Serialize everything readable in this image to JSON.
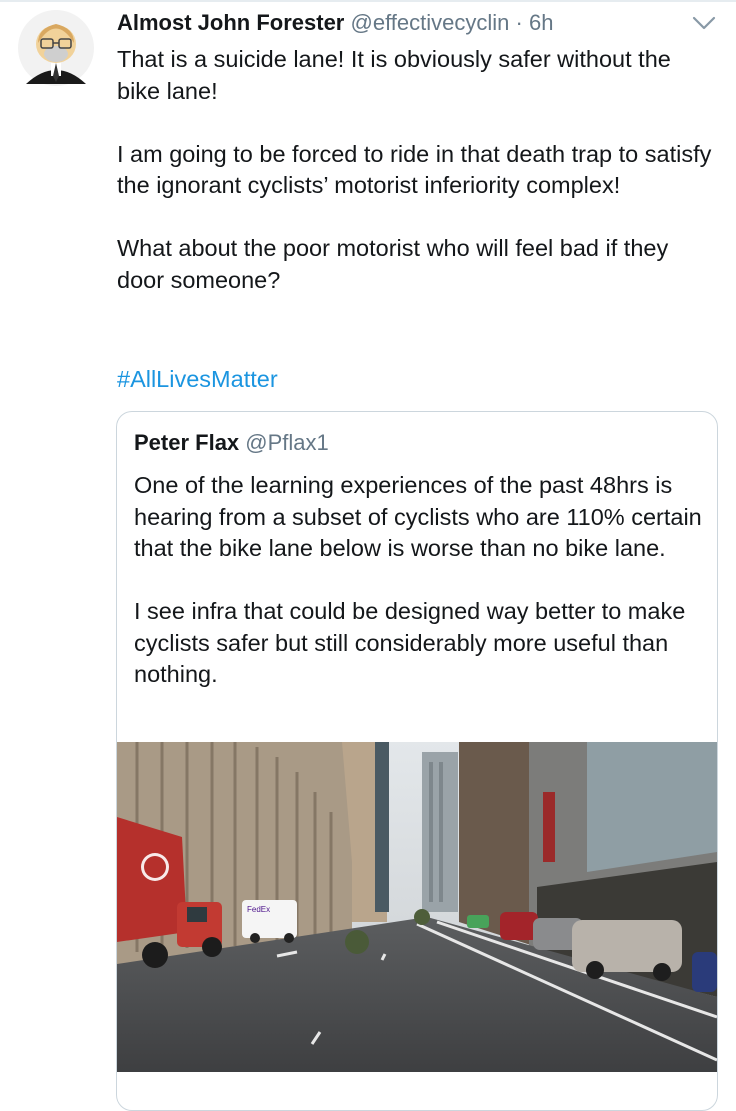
{
  "tweet": {
    "author_name": "Almost John Forester",
    "author_handle": "@effectivecyclin",
    "separator": "·",
    "time": "6h",
    "paragraphs": [
      "That is a suicide lane! It is obviously safer without the bike lane!",
      "I am going to be forced to ride in that death trap to satisfy the ignorant cyclists’ motorist inferiority complex!",
      "What about the poor motorist who will feel bad if they door someone?"
    ],
    "hashtag": "#AllLivesMatter",
    "menu_icon": "chevron-down-icon"
  },
  "quoted_tweet": {
    "author_name": "Peter Flax",
    "author_handle": "@Pflax1",
    "paragraphs": [
      "One of the learning experiences of the past 48hrs is hearing from a subset of cyclists who are 110% certain that the bike lane below is worse than no bike lane.",
      "I see infra that could be designed way better to make cyclists safer but still considerably more useful than nothing."
    ],
    "image": "city-street-bike-lane-photo"
  },
  "colors": {
    "text": "#14171a",
    "secondary": "#657786",
    "link": "#1b95e0",
    "border": "#ccd6dd"
  }
}
